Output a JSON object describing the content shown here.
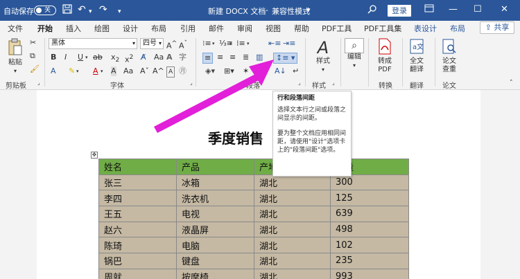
{
  "titlebar": {
    "autosave": "自动保存",
    "toggle_state": "关",
    "doc_title": "新建 DOCX 文档",
    "mode": "兼容性模式",
    "login": "登录",
    "quick_access": [
      "save-icon",
      "undo-icon",
      "redo-icon",
      "customize-icon"
    ]
  },
  "tabs": [
    "文件",
    "开始",
    "插入",
    "绘图",
    "设计",
    "布局",
    "引用",
    "邮件",
    "审阅",
    "视图",
    "帮助",
    "PDF工具",
    "PDF工具集",
    "表设计",
    "布局"
  ],
  "active_tab": "开始",
  "share": "共享",
  "ribbon": {
    "paste": "粘贴",
    "clipboard": "剪贴板",
    "font_name": "黑体",
    "font_size": "四号",
    "font_group": "字体",
    "paragraph_group": "段落",
    "styles": "样式",
    "styles_group": "样式",
    "editing": "编辑",
    "to_pdf": "转成PDF",
    "convert_group": "转换",
    "translate": "全文翻译",
    "translate_group": "翻译",
    "paper_check": "论文查重",
    "paper_group": "论文"
  },
  "tooltip": {
    "title": "行和段落间距",
    "para1": "选择文本行之间或段落之间显示的间距。",
    "para2": "要为整个文档应用相同间距，请使用\"设计\"选项卡上的\"段落间距\"选项。"
  },
  "document": {
    "heading": "季度销售",
    "table_headers": [
      "姓名",
      "产品",
      "产地",
      "销量"
    ],
    "table_rows": [
      [
        "张三",
        "冰箱",
        "湖北",
        "300"
      ],
      [
        "李四",
        "洗衣机",
        "湖北",
        "125"
      ],
      [
        "王五",
        "电视",
        "湖北",
        "639"
      ],
      [
        "赵六",
        "液晶屏",
        "湖北",
        "498"
      ],
      [
        "陈琦",
        "电脑",
        "湖北",
        "102"
      ],
      [
        "锅巴",
        "键盘",
        "湖北",
        "235"
      ],
      [
        "周就",
        "按摩椅",
        "湖北",
        "993"
      ]
    ]
  },
  "colors": {
    "titlebar": "#2b579a",
    "header_row": "#70ad47",
    "data_row": "#c5b9a4",
    "annotation_arrow": "#e21fd9"
  }
}
